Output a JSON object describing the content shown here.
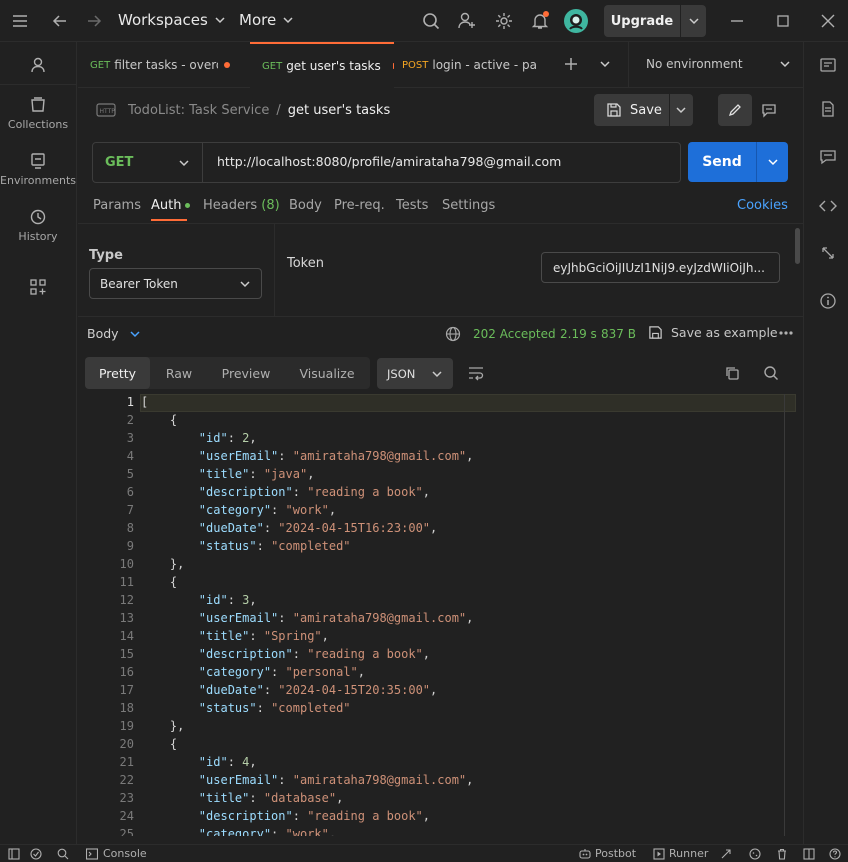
{
  "topbar": {
    "workspaces_label": "Workspaces",
    "more_label": "More",
    "upgrade_label": "Upgrade"
  },
  "sidebar": {
    "items": [
      {
        "label": "Collections",
        "icon": "collections-icon"
      },
      {
        "label": "Environments",
        "icon": "environments-icon"
      },
      {
        "label": "History",
        "icon": "history-icon"
      }
    ]
  },
  "tabs": [
    {
      "method": "GET",
      "name": "filter tasks - overdu",
      "method_color": "#6bbd5b",
      "dot_color": "#ff6c37",
      "active": false
    },
    {
      "method": "GET",
      "name": "get user's tasks",
      "method_color": "#6bbd5b",
      "dot_color": "#ff6c37",
      "active": true
    },
    {
      "method": "POST",
      "name": "login - active - pass",
      "method_color": "#f5a623",
      "active": false
    }
  ],
  "environment": {
    "label": "No environment"
  },
  "breadcrumb": {
    "collection": "TodoList: Task Service",
    "separator": "/",
    "request": "get user's tasks"
  },
  "save": {
    "label": "Save"
  },
  "request": {
    "method": "GET",
    "url": "http://localhost:8080/profile/amirataha798@gmail.com",
    "send_label": "Send"
  },
  "request_tabs": {
    "params": "Params",
    "auth": "Auth",
    "headers": "Headers",
    "headers_count": "(8)",
    "body": "Body",
    "prereq": "Pre-req.",
    "tests": "Tests",
    "settings": "Settings",
    "cookies": "Cookies"
  },
  "auth": {
    "type_label": "Type",
    "type_value": "Bearer Token",
    "token_label": "Token",
    "token_value": "eyJhbGciOiJIUzI1NiJ9.eyJzdWIiOiJh..."
  },
  "response": {
    "body_label": "Body",
    "status": "202 Accepted",
    "time": "2.19 s",
    "size": "837 B",
    "save_example": "Save as example",
    "view_tabs": [
      "Pretty",
      "Raw",
      "Preview",
      "Visualize"
    ],
    "format": "JSON"
  },
  "code_lines": [
    "[",
    "    {",
    "        \"id\": 2,",
    "        \"userEmail\": \"amirataha798@gmail.com\",",
    "        \"title\": \"java\",",
    "        \"description\": \"reading a book\",",
    "        \"category\": \"work\",",
    "        \"dueDate\": \"2024-04-15T16:23:00\",",
    "        \"status\": \"completed\"",
    "    },",
    "    {",
    "        \"id\": 3,",
    "        \"userEmail\": \"amirataha798@gmail.com\",",
    "        \"title\": \"Spring\",",
    "        \"description\": \"reading a book\",",
    "        \"category\": \"personal\",",
    "        \"dueDate\": \"2024-04-15T20:35:00\",",
    "        \"status\": \"completed\"",
    "    },",
    "    {",
    "        \"id\": 4,",
    "        \"userEmail\": \"amirataha798@gmail.com\",",
    "        \"title\": \"database\",",
    "        \"description\": \"reading a book\",",
    "        \"category\": \"work\","
  ],
  "statusbar": {
    "console": "Console",
    "postbot": "Postbot",
    "runner": "Runner"
  },
  "colors": {
    "accent": "#1e6fd9",
    "method_get": "#6bbd5b",
    "status_ok": "#6bbd5b",
    "cookies": "#4aa3ff",
    "orange": "#ff6c37"
  }
}
